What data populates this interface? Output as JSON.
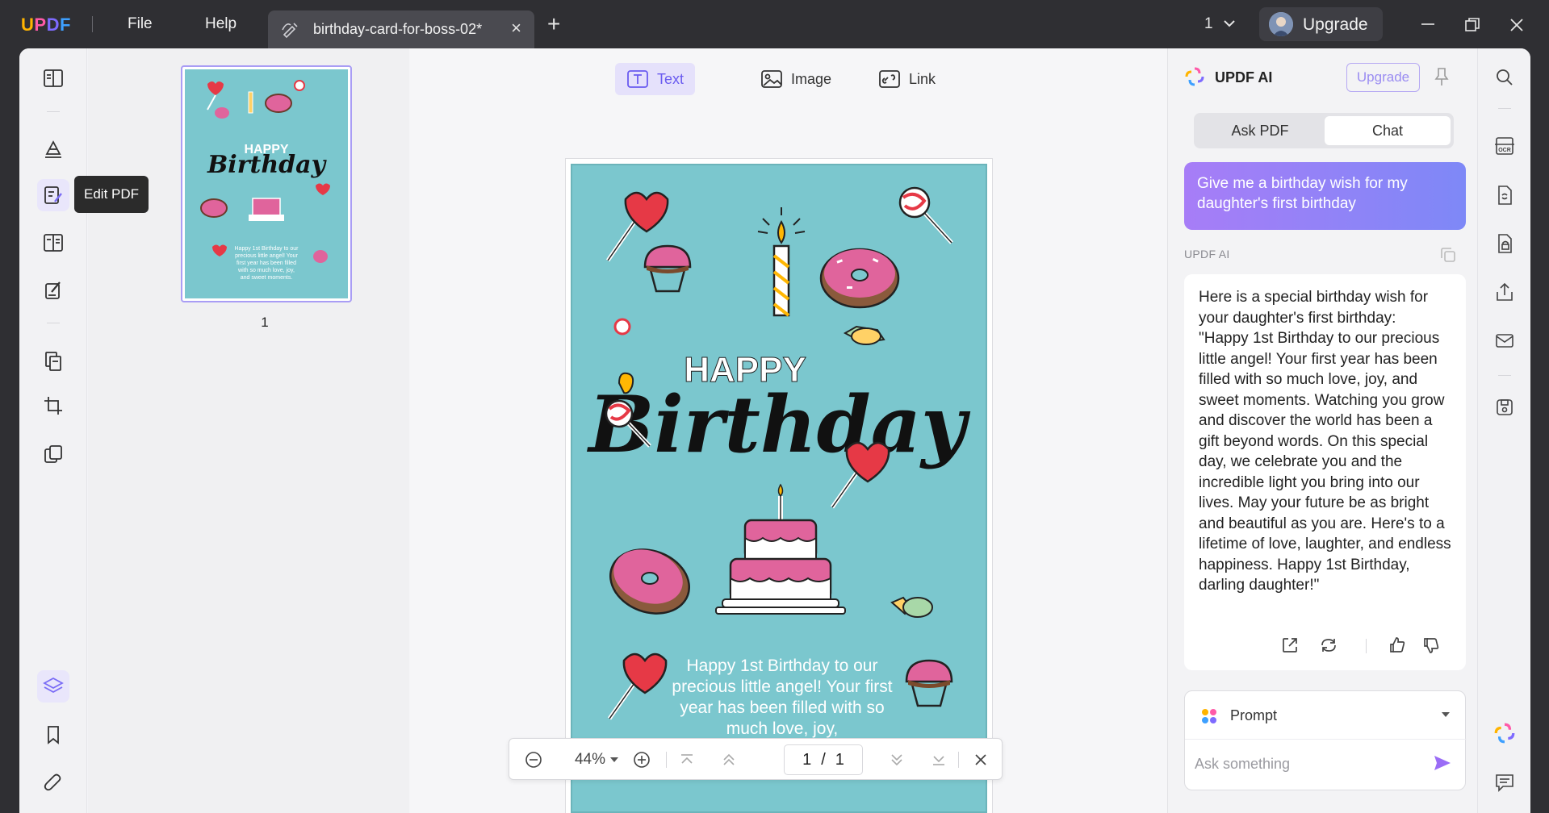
{
  "app": {
    "logo_parts": [
      "U",
      "P",
      "D",
      "F"
    ],
    "menu": [
      "File",
      "Help"
    ],
    "tab_title": "birthday-card-for-boss-02*",
    "window_count": "1",
    "upgrade_label": "Upgrade"
  },
  "left_toolbar": {
    "tooltip": "Edit PDF"
  },
  "thumbnails": {
    "page_number": "1"
  },
  "edit_toolbar": {
    "text_label": "Text",
    "image_label": "Image",
    "link_label": "Link",
    "active": "Text"
  },
  "document": {
    "happy": "HAPPY",
    "birthday": "Birthday",
    "body_text": "Happy 1st Birthday to our precious little angel! Your first year has been filled with so much love, joy,",
    "card_color": "#7bc7ce"
  },
  "zoom_bar": {
    "zoom": "44%",
    "current_page": "1",
    "page_separator": "/",
    "total_pages": "1"
  },
  "ai_panel": {
    "title": "UPDF AI",
    "upgrade_label": "Upgrade",
    "tabs": [
      "Ask PDF",
      "Chat"
    ],
    "active_tab": "Chat",
    "user_message": "Give me a birthday wish for my daughter's first birthday",
    "response_label": "UPDF AI",
    "response_intro": "Here is a special birthday wish for your daughter's first birthday:",
    "response_body": "\"Happy 1st Birthday to our precious little angel! Your first year has been filled with so much love, joy, and sweet moments. Watching you grow and discover the world has been a gift beyond words. On this special day, we celebrate you and the incredible light you bring into our lives. May your future be as bright and beautiful as you are. Here's to a lifetime of love, laughter, and endless happiness. Happy 1st Birthday, darling daughter!\"",
    "prompt_label": "Prompt",
    "input_placeholder": "Ask something",
    "accent": "#7a6cf6"
  }
}
